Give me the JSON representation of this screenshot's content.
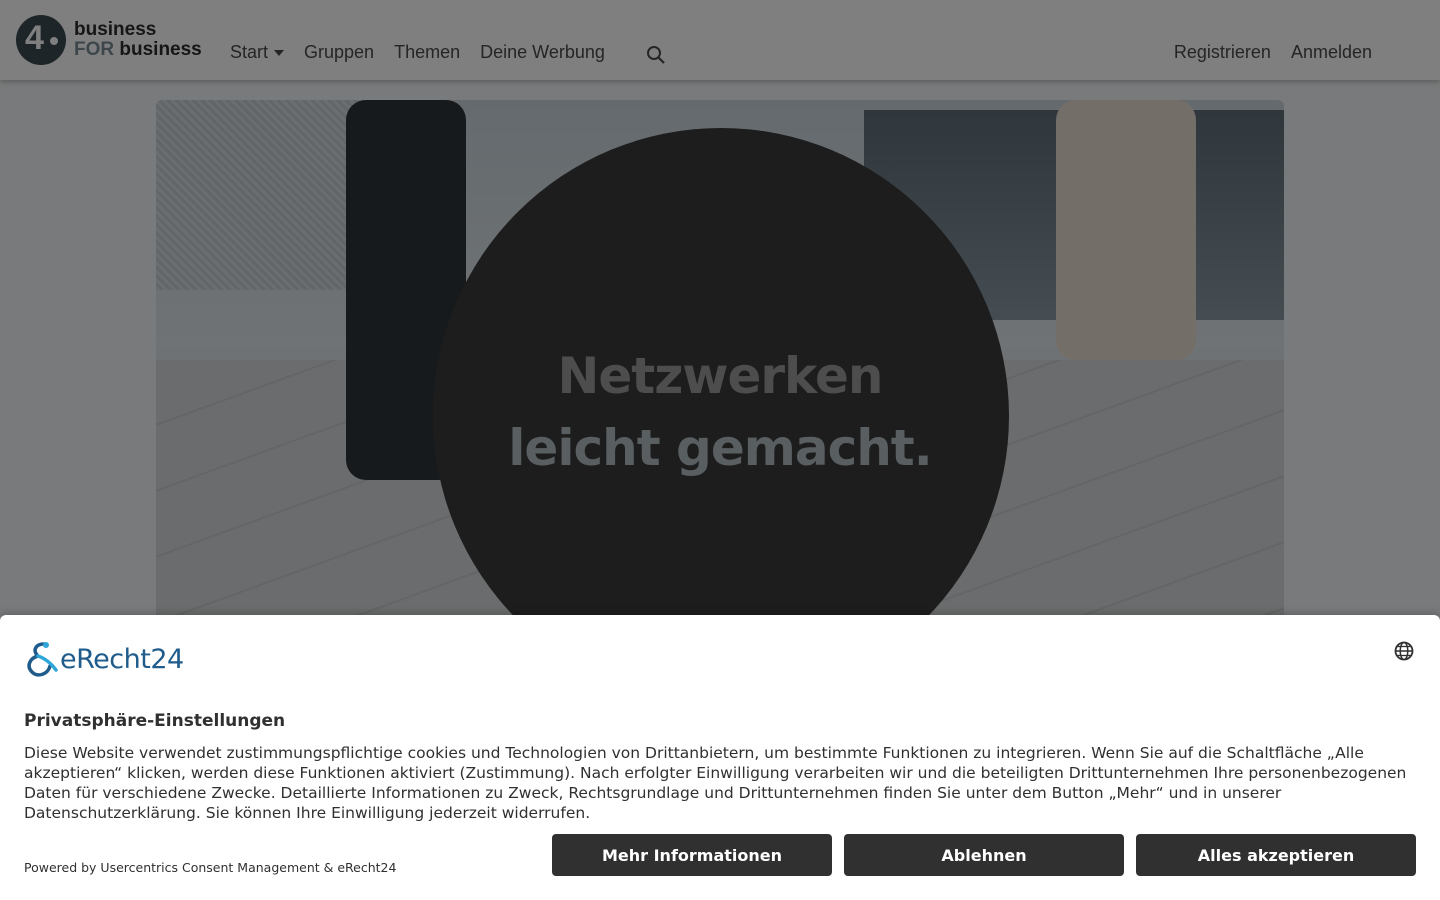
{
  "navbar": {
    "logo": {
      "line1": "business",
      "line2_for": "FOR",
      "line2_rest": " business"
    },
    "links": [
      {
        "label": "Start"
      },
      {
        "label": "Gruppen"
      },
      {
        "label": "Themen"
      },
      {
        "label": "Deine Werbung"
      }
    ],
    "right_links": [
      {
        "label": "Registrieren"
      },
      {
        "label": "Anmelden"
      }
    ]
  },
  "hero": {
    "headline_line1": "Netzwerken",
    "headline_line2": "leicht gemacht."
  },
  "consent": {
    "brand": "eRecht24",
    "title": "Privatsphäre-Einstellungen",
    "body": "Diese Website verwendet zustimmungspflichtige cookies und Technologien von Drittanbietern, um bestimmte Funktionen zu integrieren. Wenn Sie auf die Schaltfläche „Alle akzeptieren“ klicken, werden diese Funktionen aktiviert (Zustimmung). Nach erfolgter Einwilligung verarbeiten wir und die beteiligten Drittunternehmen Ihre personenbezogenen Daten für verschiedene Zwecke. Detaillierte Informationen zu Zweck, Rechtsgrundlage und Drittunternehmen finden Sie unter dem Button „Mehr“ und in unserer Datenschutzerklärung. Sie können Ihre Einwilligung jederzeit widerrufen.",
    "powered_by": "Powered by Usercentrics Consent Management & eRecht24",
    "buttons": {
      "more": "Mehr Informationen",
      "deny": "Ablehnen",
      "accept": "Alles akzeptieren"
    }
  },
  "colors": {
    "button_bg": "#303030",
    "brand_blue": "#1f5c8c",
    "overlay": "rgba(0,0,0,0.5)"
  },
  "icons": [
    "search-icon",
    "globe-icon",
    "caret-down-icon",
    "erecht24-logo-icon"
  ]
}
